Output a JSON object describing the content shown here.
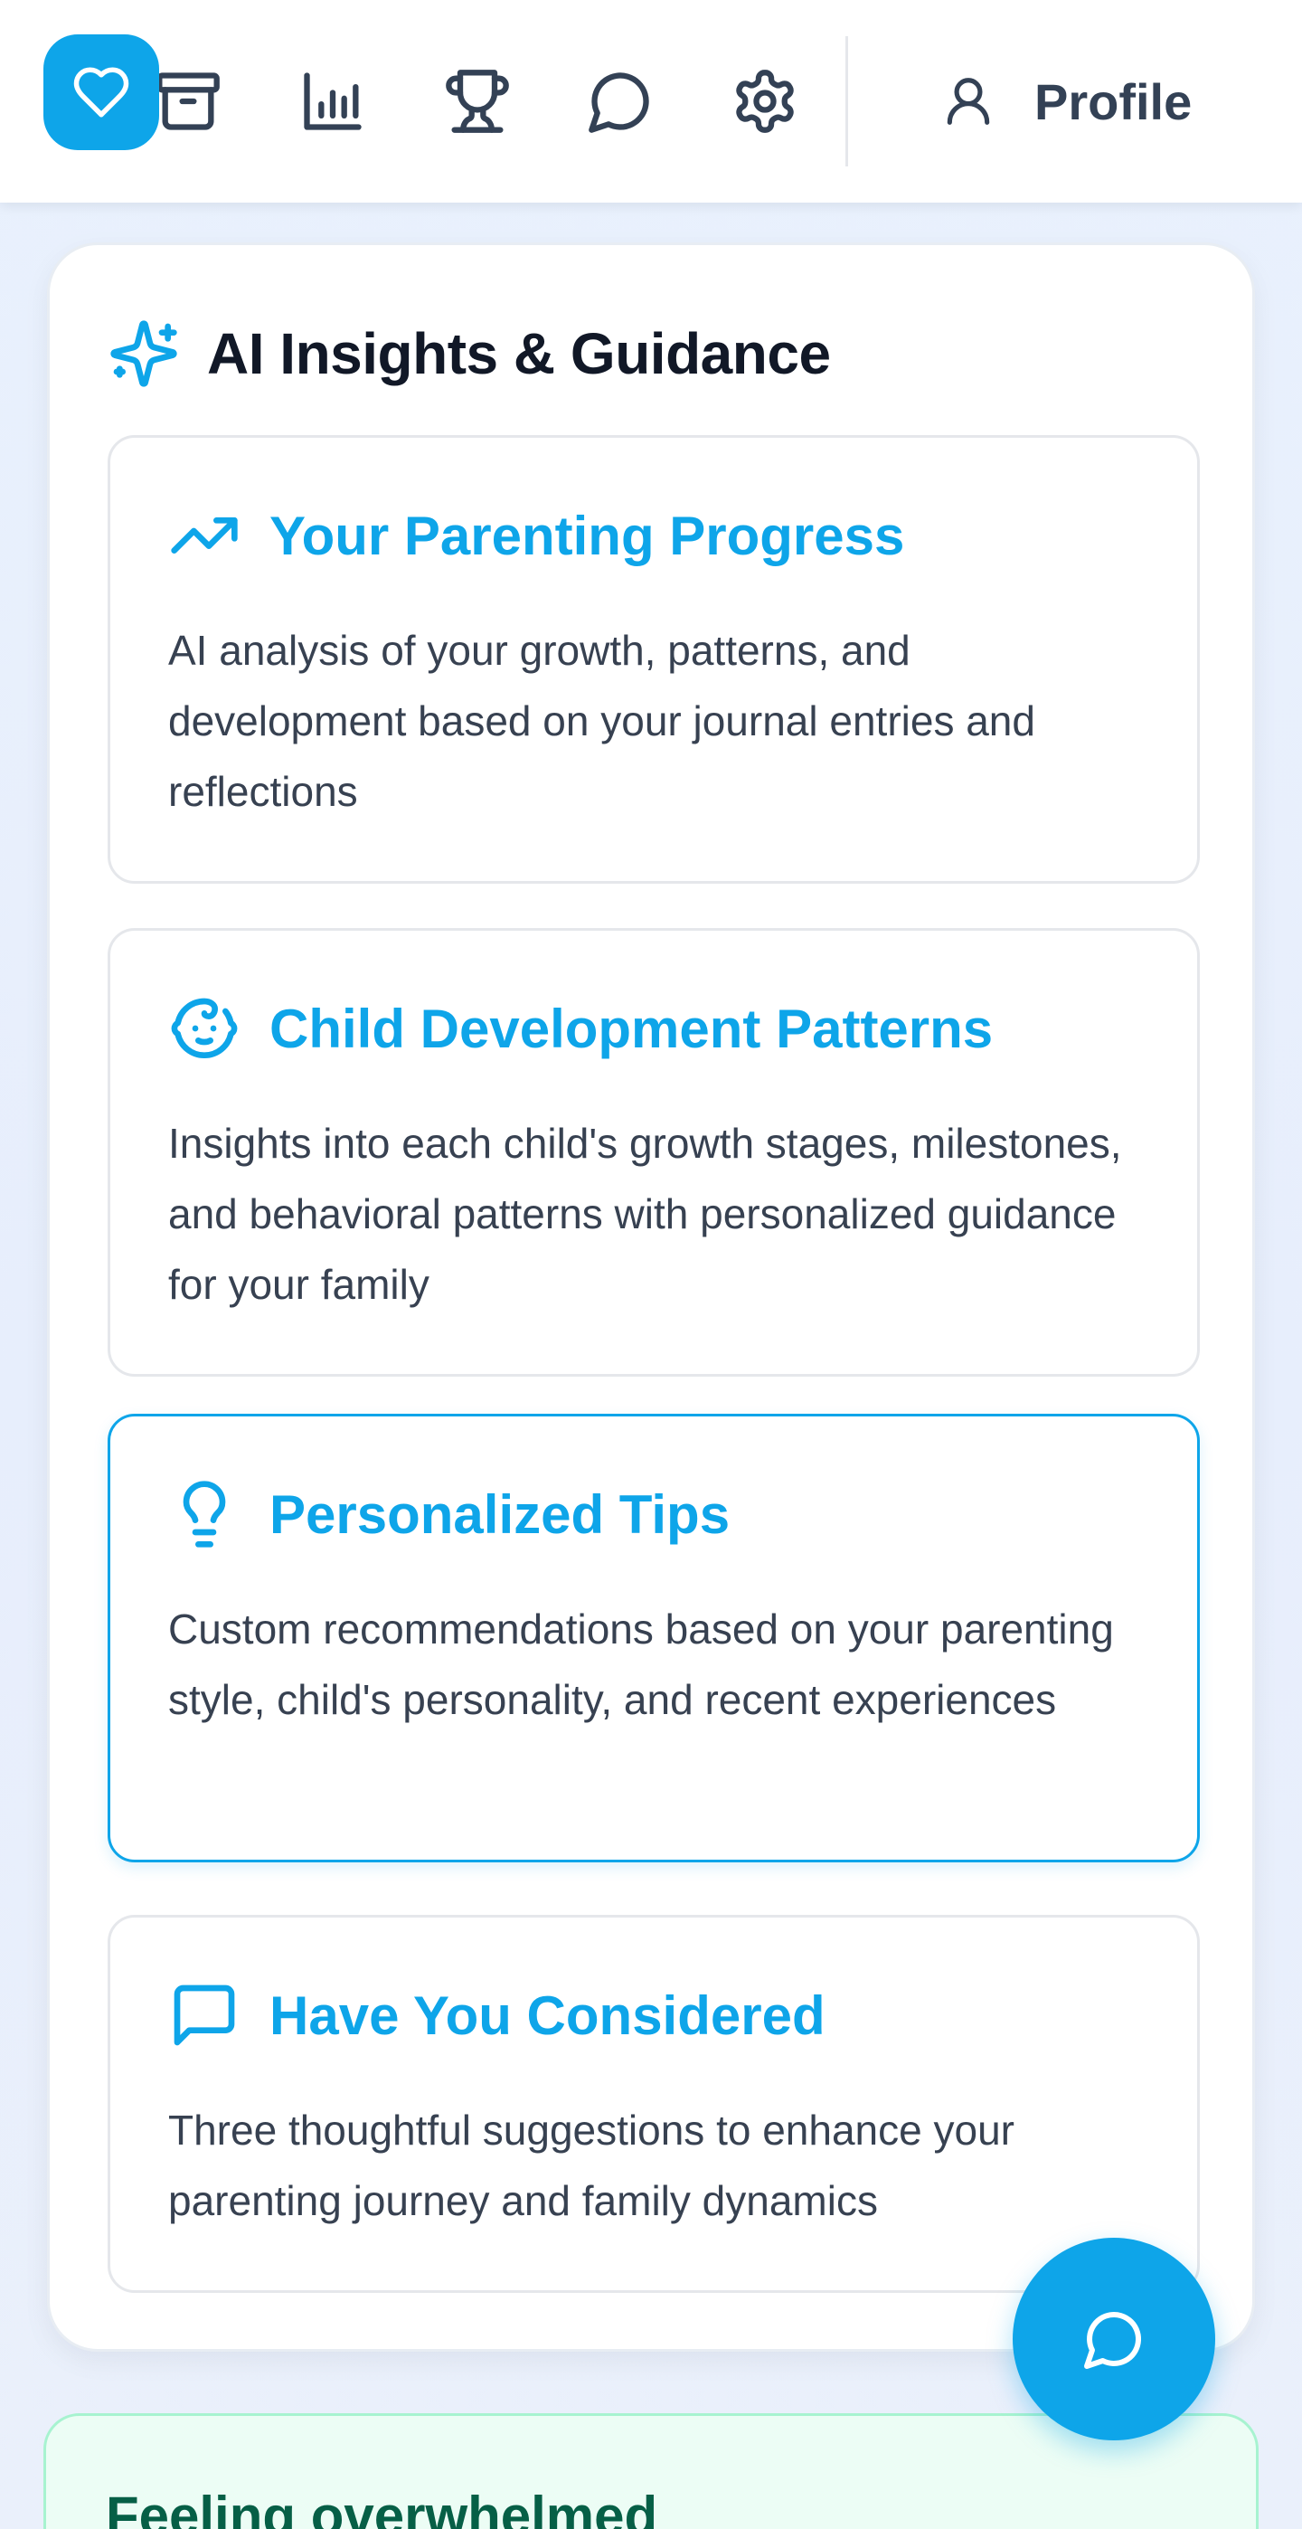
{
  "nav": {
    "items": [
      {
        "icon": "heart-icon",
        "active": true
      },
      {
        "icon": "archive-icon",
        "active": false
      },
      {
        "icon": "bar-chart-icon",
        "active": false
      },
      {
        "icon": "trophy-icon",
        "active": false
      },
      {
        "icon": "message-circle-icon",
        "active": false
      },
      {
        "icon": "gear-icon",
        "active": false
      }
    ],
    "profile": {
      "icon": "user-icon",
      "label": "Profile"
    }
  },
  "insights": {
    "icon": "sparkles-icon",
    "title": "AI Insights & Guidance",
    "items": [
      {
        "icon": "trending-up-icon",
        "title": "Your Parenting Progress",
        "description": "AI analysis of your growth, patterns, and development based on your journal entries and reflections",
        "highlighted": false
      },
      {
        "icon": "baby-face-icon",
        "title": "Child Development Patterns",
        "description": "Insights into each child's growth stages, milestones, and behavioral patterns with personalized guidance for your family",
        "highlighted": false
      },
      {
        "icon": "lightbulb-icon",
        "title": "Personalized Tips",
        "description": "Custom recommendations based on your parenting style, child's personality, and recent experiences",
        "highlighted": true
      },
      {
        "icon": "message-square-icon",
        "title": "Have You Considered",
        "description": "Three thoughtful suggestions to enhance your parenting journey and family dynamics",
        "highlighted": false
      }
    ]
  },
  "support": {
    "title": "Feeling overwhelmed"
  },
  "fab": {
    "icon": "chat-icon"
  },
  "colors": {
    "accent": "#0ea5e9",
    "heading": "#111827",
    "body_text": "#374151",
    "support_bg": "#ecfdf5",
    "support_text": "#065f46"
  }
}
